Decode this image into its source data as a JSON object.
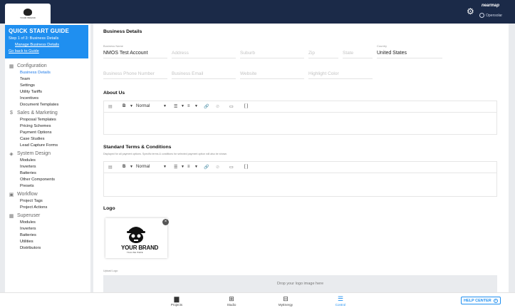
{
  "topbar": {
    "logo_text": "YOUR BRAND",
    "brand_name": "nearmap",
    "org_label": "Opensolar"
  },
  "quick_start": {
    "title": "QUICK START GUIDE",
    "step": "Step 1 of 3: Business Details",
    "manage_link": "Manage Business Details",
    "back_link": "Go back to Guide"
  },
  "nav": {
    "configuration": {
      "label": "Configuration",
      "items": [
        "Business Details",
        "Team",
        "Settings",
        "Utility Tariffs",
        "Incentives",
        "Document Templates"
      ]
    },
    "sales": {
      "label": "Sales & Marketing",
      "items": [
        "Proposal Templates",
        "Pricing Schemes",
        "Payment Options",
        "Case Studies",
        "Lead Capture Forms"
      ]
    },
    "system_design": {
      "label": "System Design",
      "items": [
        "Modules",
        "Inverters",
        "Batteries",
        "Other Components",
        "Presets"
      ]
    },
    "workflow": {
      "label": "Workflow",
      "items": [
        "Project Tags",
        "Project Actions"
      ]
    },
    "superuser": {
      "label": "Superuser",
      "items": [
        "Modules",
        "Inverters",
        "Batteries",
        "Utilities",
        "Distributors"
      ]
    }
  },
  "business": {
    "heading": "Business Details",
    "name_label": "Business Name",
    "name_value": "NMOS Test Account",
    "address_ph": "Address",
    "suburb_ph": "Suburb",
    "zip_ph": "Zip",
    "state_ph": "State",
    "country_label": "Country",
    "country_value": "United States",
    "phone_ph": "Business Phone Number",
    "email_ph": "Business Email",
    "website_ph": "Website",
    "highlight_ph": "Highlight Color"
  },
  "about": {
    "heading": "About Us",
    "format_label": "Normal"
  },
  "terms": {
    "heading": "Standard Terms & Conditions",
    "note": "Displayed for all payment options. Specific terms & conditions for selected payment option will also be shown.",
    "format_label": "Normal"
  },
  "logo": {
    "heading": "Logo",
    "brand_text": "YOUR BRAND",
    "brand_sub": "TAGLINE HERE",
    "upload_label": "Upload Logo",
    "drop_text": "Drop your logo image here"
  },
  "bottombar": {
    "items": [
      "Projects",
      "Studio",
      "MyEnergy",
      "Control"
    ],
    "help_label": "HELP CENTER"
  },
  "colors": {
    "topbar": "#1b2a48",
    "accent": "#1f8ff0"
  }
}
